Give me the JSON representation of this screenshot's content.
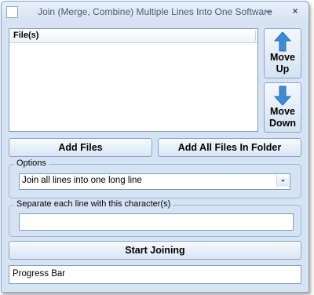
{
  "window": {
    "title": "Join (Merge, Combine) Multiple Lines Into One Software",
    "minimize_glyph": "–",
    "close_glyph": "×"
  },
  "file_list": {
    "header": "File(s)",
    "items": []
  },
  "move_up": {
    "line1": "Move",
    "line2": "Up",
    "icon": "arrow-up-icon"
  },
  "move_down": {
    "line1": "Move",
    "line2": "Down",
    "icon": "arrow-down-icon"
  },
  "buttons": {
    "add_files": "Add Files",
    "add_folder": "Add All Files In Folder",
    "start": "Start Joining"
  },
  "options": {
    "legend": "Options",
    "selected": "Join all lines into one long line"
  },
  "separator": {
    "legend": "Separate each line with this character(s)",
    "value": ""
  },
  "progress": {
    "label": "Progress Bar",
    "value": 0
  },
  "colors": {
    "arrow": "#3d8ad6",
    "frame": "#d6e3f5"
  }
}
